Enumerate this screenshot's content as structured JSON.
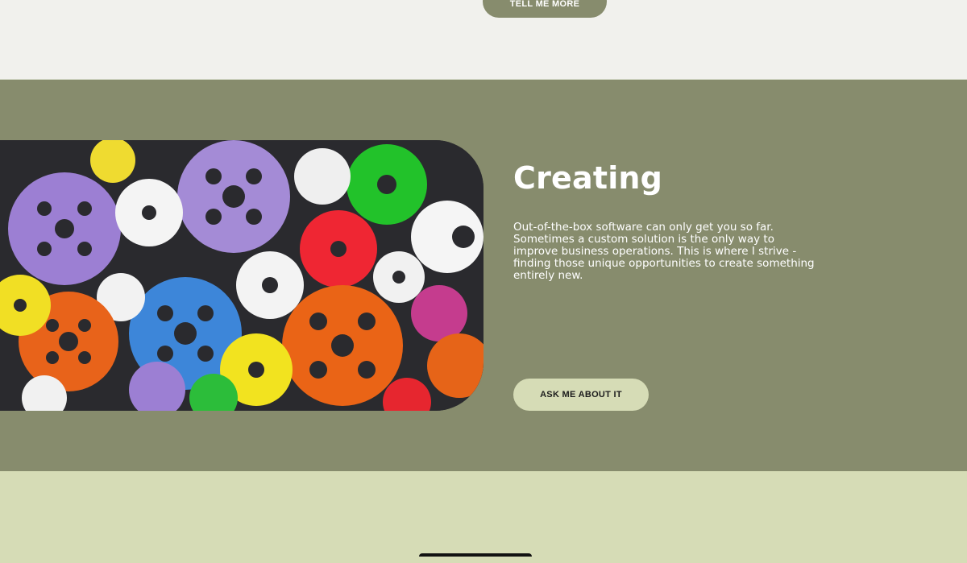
{
  "top_section": {
    "tell_me_more_label": "TELL ME MORE"
  },
  "feature": {
    "title": "Creating",
    "description": "Out-of-the-box software can only get you so far. Sometimes a custom solution is the only way to improve business operations. This is where I strive - finding those unique opportunities to create something entirely new.",
    "cta_label": "ASK ME ABOUT IT",
    "image_subject": "colorful gears"
  },
  "colors": {
    "page_bg": "#f1f1ed",
    "olive": "#878c6d",
    "sage_light": "#d6dcb6",
    "white": "#ffffff"
  }
}
